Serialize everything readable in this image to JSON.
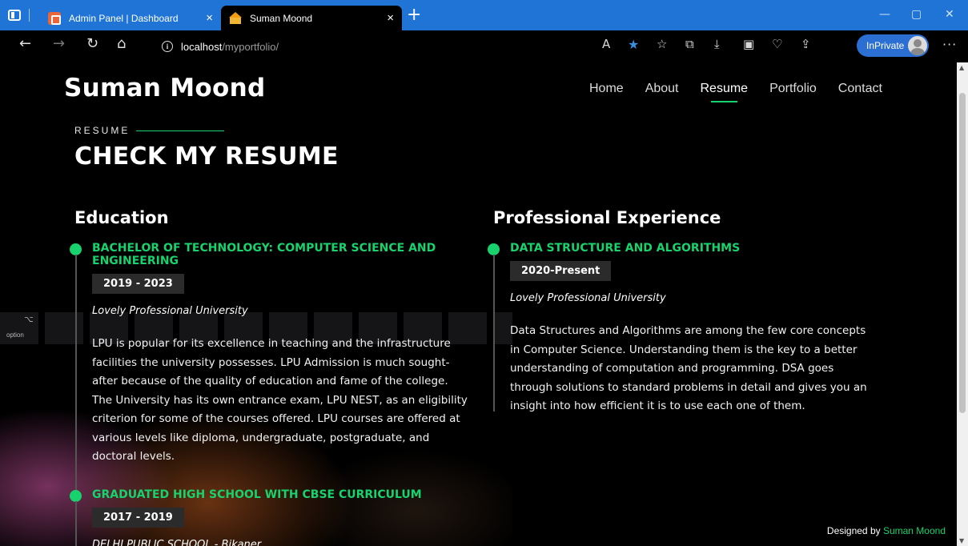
{
  "browser": {
    "tabs": [
      {
        "label": "Admin Panel | Dashboard",
        "active": false
      },
      {
        "label": "Suman Moond",
        "active": true
      }
    ],
    "new_tab_glyph": "+",
    "close_glyph": "×",
    "window_controls": {
      "minimize": "—",
      "restore": "▢",
      "close": "✕"
    },
    "address": {
      "host": "localhost",
      "path": "/myportfolio/"
    },
    "toolbar_icons": [
      "back-icon",
      "forward-icon",
      "refresh-icon",
      "home-icon",
      "info-icon",
      "read-aloud-icon",
      "favorite-star-icon",
      "favorites-icon",
      "collections-icon",
      "downloads-icon",
      "screenshot-icon",
      "browser-essentials-icon",
      "share-icon"
    ],
    "inprivate_label": "InPrivate",
    "more_glyph": "···",
    "accent": "#1f74d6"
  },
  "site": {
    "brand": "Suman Moond",
    "nav": [
      {
        "label": "Home",
        "active": false
      },
      {
        "label": "About",
        "active": false
      },
      {
        "label": "Resume",
        "active": true
      },
      {
        "label": "Portfolio",
        "active": false
      },
      {
        "label": "Contact",
        "active": false
      }
    ],
    "accent": "#18d26e"
  },
  "resume": {
    "kicker": "RESUME",
    "title": "CHECK MY RESUME",
    "education": {
      "title": "Education",
      "items": [
        {
          "heading": "BACHELOR OF TECHNOLOGY: COMPUTER SCIENCE AND ENGINEERING",
          "date": "2019 - 2023",
          "org": "Lovely Professional University",
          "desc": "LPU is popular for its excellence in teaching and the infrastructure facilities the university possesses. LPU Admission is much sought-after because of the quality of education and fame of the college. The University has its own entrance exam, LPU NEST, as an eligibility criterion for some of the courses offered. LPU courses are offered at various levels like diploma, undergraduate, postgraduate, and doctoral levels."
        },
        {
          "heading": "GRADUATED HIGH SCHOOL WITH CBSE CURRICULUM",
          "date": "2017 - 2019",
          "org": "DELHI PUBLIC SCHOOL - Bikaner",
          "desc": ""
        }
      ]
    },
    "experience": {
      "title": "Professional Experience",
      "items": [
        {
          "heading": "DATA STRUCTURE AND ALGORITHMS",
          "date": "2020-Present",
          "org": "Lovely Professional University",
          "desc": "Data Structures and Algorithms are among the few core concepts in Computer Science. Understanding them is the key to a better understanding of computation and programming. DSA goes through solutions to standard problems in detail and gives you an insight into how efficient it is to use each one of them."
        }
      ]
    }
  },
  "footer": {
    "credit_prefix": "Designed by ",
    "credit_name": "Suman Moond"
  },
  "background_decor": {
    "key_label": "option",
    "key_symbol": "⌥"
  }
}
